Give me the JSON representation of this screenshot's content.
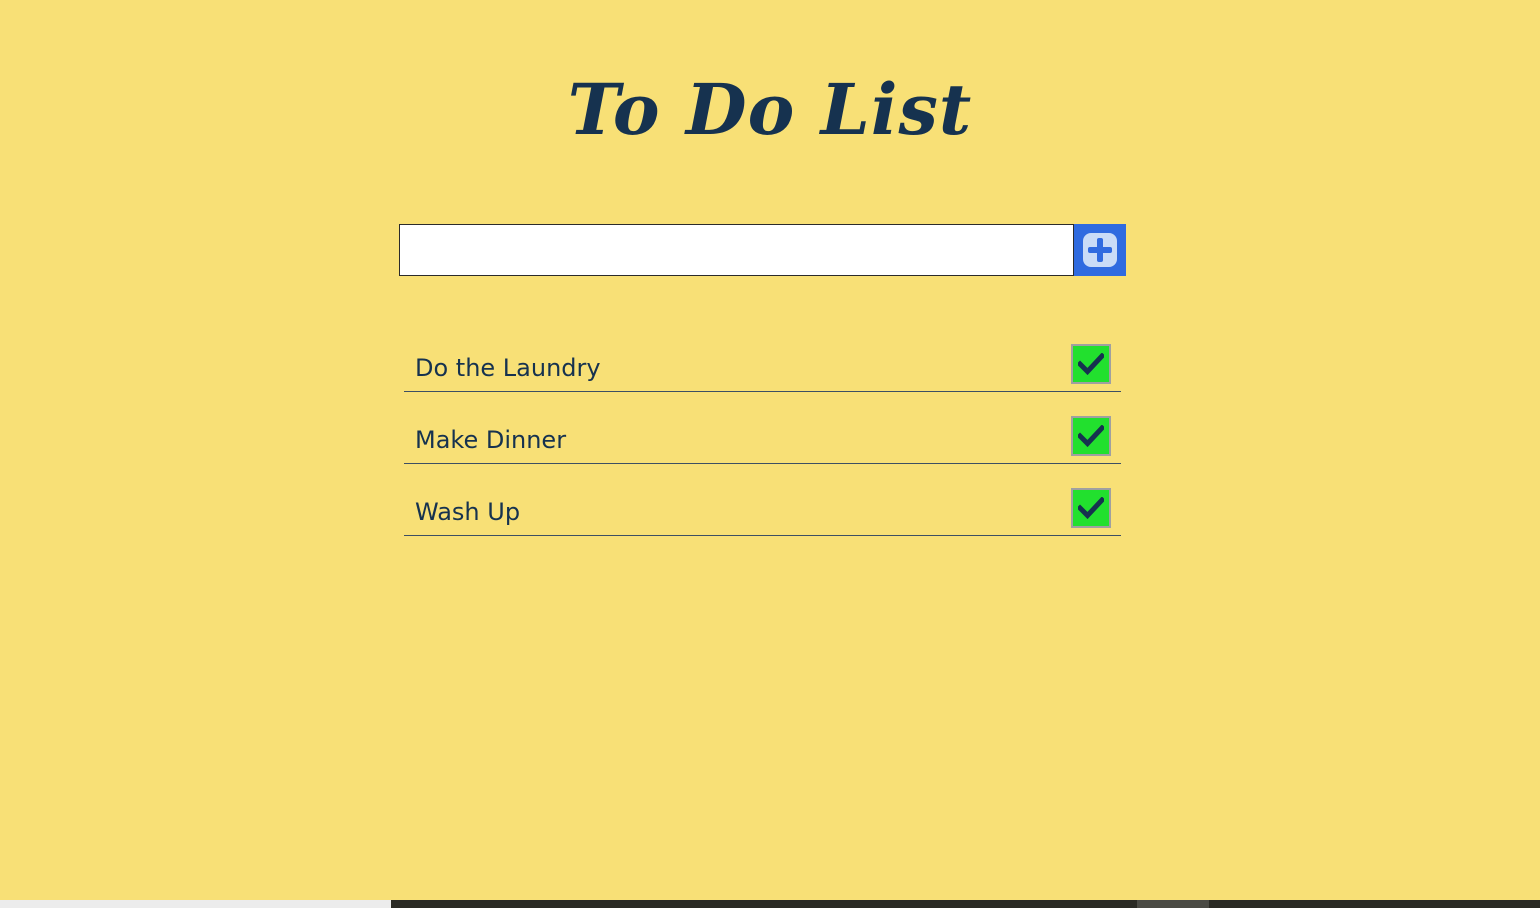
{
  "app": {
    "title": "To Do List"
  },
  "new_item": {
    "value": "",
    "placeholder": ""
  },
  "todos": [
    {
      "label": "Do the Laundry"
    },
    {
      "label": "Make Dinner"
    },
    {
      "label": "Wash Up"
    }
  ],
  "icons": {
    "add": "plus-square-icon",
    "check": "checkmark-icon"
  },
  "colors": {
    "background": "#f8e076",
    "text": "#16324f",
    "add_button": "#2f6be0",
    "check_button": "#22e02e"
  }
}
